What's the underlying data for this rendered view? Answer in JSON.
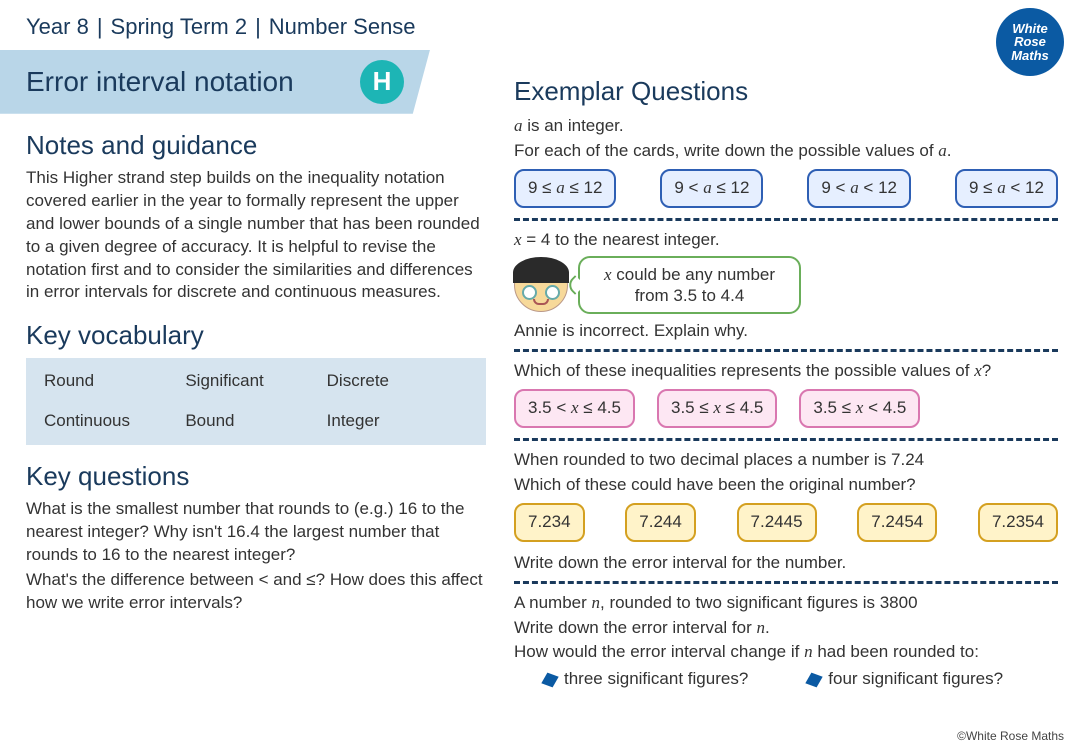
{
  "header": {
    "year": "Year 8",
    "term": "Spring Term 2",
    "topic": "Number Sense"
  },
  "logo_lines": [
    "White",
    "Rose",
    "Maths"
  ],
  "title": "Error interval notation",
  "badge": "H",
  "left": {
    "notes_heading": "Notes and guidance",
    "notes_body": "This Higher strand step builds on the inequality notation covered earlier in the year to formally represent the upper and lower bounds of a single number that has been rounded to a given degree of accuracy. It is helpful to revise the notation first and to consider the similarities and differences in error intervals for discrete and continuous measures.",
    "vocab_heading": "Key vocabulary",
    "vocab": [
      "Round",
      "Significant",
      "Discrete",
      "Continuous",
      "Bound",
      "Integer"
    ],
    "questions_heading": "Key questions",
    "questions_body_1": "What is the smallest number that rounds to (e.g.) 16 to the nearest integer? Why isn't 16.4 the largest number that rounds to 16 to the nearest integer?",
    "questions_body_2": "What's the difference between < and ≤? How does this affect how we write error intervals?"
  },
  "right": {
    "heading": "Exemplar Questions",
    "q1_line1": "a is an integer.",
    "q1_line2": "For each of the cards, write down the possible values of a.",
    "q1_cards": [
      "9 ≤ a ≤ 12",
      "9 < a ≤ 12",
      "9 < a < 12",
      "9 ≤ a < 12"
    ],
    "q2_line1": "x = 4 to the nearest integer.",
    "q2_speech_l1": "x could be any number",
    "q2_speech_l2": "from 3.5 to 4.4",
    "q2_line2": "Annie is incorrect.  Explain why.",
    "q3_line1": "Which of these inequalities represents the possible values of x?",
    "q3_cards": [
      "3.5 < x ≤ 4.5",
      "3.5 ≤ x ≤ 4.5",
      "3.5 ≤ x < 4.5"
    ],
    "q4_line1": "When rounded to two decimal places a number is 7.24",
    "q4_line2": "Which of these could have been the original number?",
    "q4_cards": [
      "7.234",
      "7.244",
      "7.2445",
      "7.2454",
      "7.2354"
    ],
    "q4_line3": "Write down the error interval for the number.",
    "q5_line1": "A number n, rounded to two significant figures is 3800",
    "q5_line2": "Write down the error interval for n.",
    "q5_line3": "How would the error interval change if n had been rounded to:",
    "q5_bullet1": "three significant figures?",
    "q5_bullet2": "four significant figures?"
  },
  "footer": "©White Rose Maths"
}
